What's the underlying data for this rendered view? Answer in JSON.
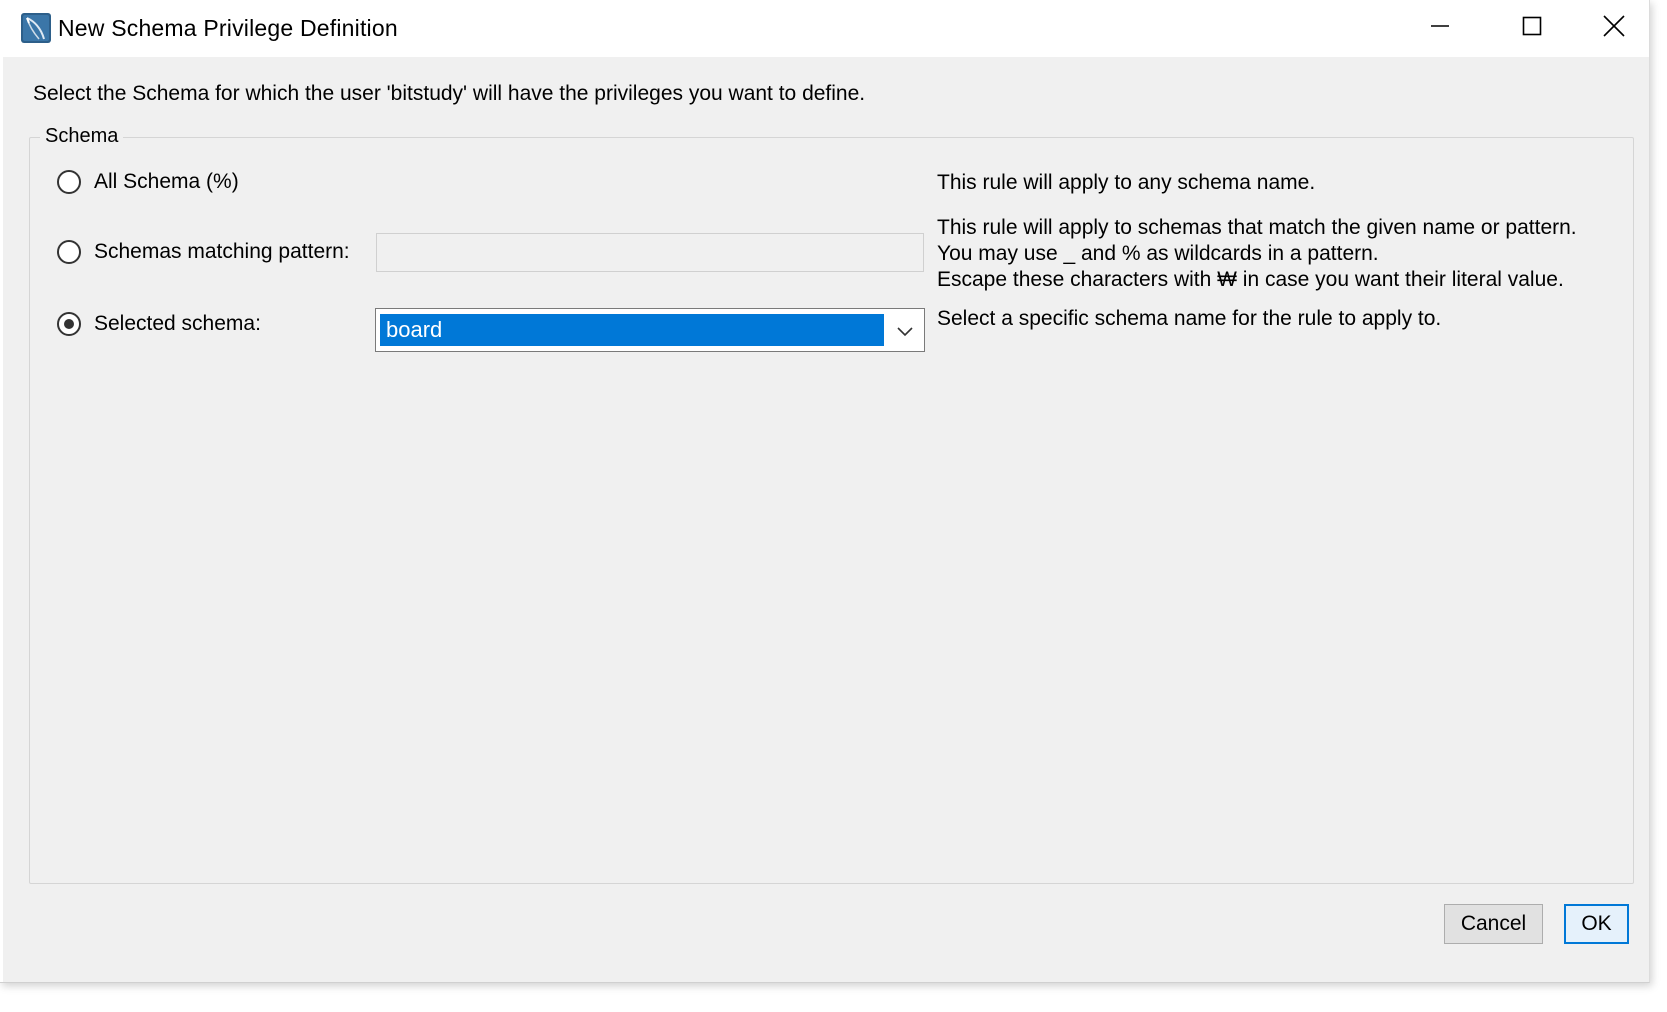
{
  "window": {
    "title": "New Schema Privilege Definition",
    "icons": {
      "app": "mysql-workbench-icon",
      "minimize": "minimize-icon",
      "maximize": "maximize-icon",
      "close": "close-icon"
    }
  },
  "instruction": "Select the Schema for which the user 'bitstudy' will have the privileges you want to define.",
  "schema_group": {
    "legend": "Schema",
    "options": [
      {
        "label": "All Schema (%)",
        "selected": false,
        "description": [
          "This rule will apply to any schema name."
        ]
      },
      {
        "label": "Schemas matching pattern:",
        "selected": false,
        "input_value": "",
        "description": [
          "This rule will apply to schemas that match the given name or pattern.",
          "You may use _ and % as wildcards in a pattern.",
          "Escape these characters with ₩ in case you want their literal value."
        ]
      },
      {
        "label": "Selected schema:",
        "selected": true,
        "combo_value": "board",
        "combo_icon": "chevron-down-icon",
        "description": [
          "Select a specific schema name for the rule to apply to."
        ]
      }
    ]
  },
  "buttons": {
    "cancel": "Cancel",
    "ok": "OK"
  },
  "colors": {
    "accent": "#0078d7",
    "dialog_bg": "#f0f0f0",
    "titlebar_bg": "#ffffff"
  }
}
